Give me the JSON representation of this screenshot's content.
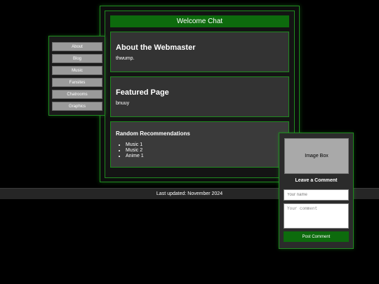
{
  "header": {
    "welcome": "Welcome Chat"
  },
  "sidebar": {
    "items": [
      {
        "label": "About"
      },
      {
        "label": "Blog"
      },
      {
        "label": "Music"
      },
      {
        "label": "Fansites"
      },
      {
        "label": "Chatrooms"
      },
      {
        "label": "Graphics"
      }
    ]
  },
  "main": {
    "about": {
      "title": "About the Webmaster",
      "text": "thwump."
    },
    "featured": {
      "title": "Featured Page",
      "text": "bnuuy"
    },
    "recommendations": {
      "title": "Random Recommendations",
      "items": [
        "Music 1",
        "Music 2",
        "Anime 1"
      ]
    }
  },
  "footer": {
    "text": "Last updated: November 2024"
  },
  "comment": {
    "image_label": "Image Box",
    "title": "Leave a Comment",
    "name_placeholder": "Your name",
    "comment_placeholder": "Your comment",
    "button_label": "Post Comment"
  },
  "colors": {
    "accent": "#0d6b0d",
    "border": "#1f8a1f",
    "background": "#000000",
    "panel": "#333333"
  }
}
